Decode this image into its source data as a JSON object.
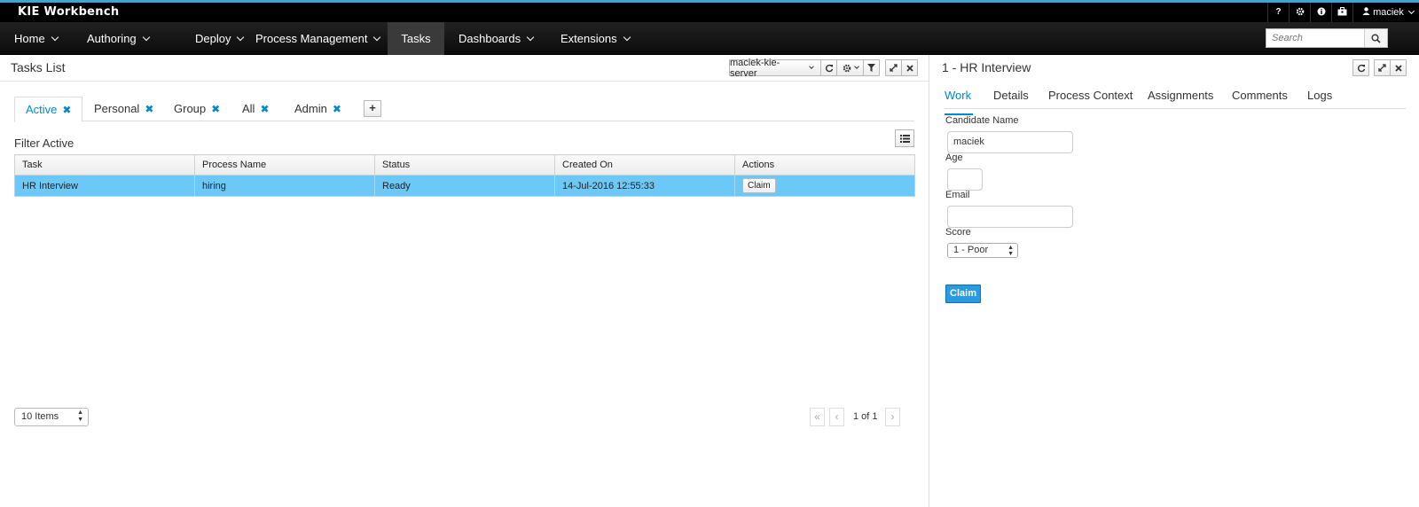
{
  "app": {
    "brand": "KIE Workbench",
    "user": "maciek"
  },
  "nav": {
    "items": [
      {
        "label": "Home",
        "dropdown": true
      },
      {
        "label": "Authoring",
        "dropdown": true
      },
      {
        "label": "Deploy",
        "dropdown": true
      },
      {
        "label": "Process Management",
        "dropdown": true
      },
      {
        "label": "Tasks",
        "dropdown": false,
        "active": true
      },
      {
        "label": "Dashboards",
        "dropdown": true
      },
      {
        "label": "Extensions",
        "dropdown": true
      }
    ],
    "search_placeholder": "Search"
  },
  "utility_icons": [
    "help-icon",
    "gear-icon",
    "info-icon",
    "briefcase-icon",
    "user-icon"
  ],
  "tasks_panel": {
    "title": "Tasks List",
    "server_select": "maciek-kie-server",
    "tabs": [
      {
        "label": "Active",
        "active": true
      },
      {
        "label": "Personal"
      },
      {
        "label": "Group"
      },
      {
        "label": "All"
      },
      {
        "label": "Admin"
      }
    ],
    "add_tab_label": "+",
    "filter_label": "Filter Active",
    "table": {
      "columns": [
        "Task",
        "Process Name",
        "Status",
        "Created On",
        "Actions"
      ],
      "rows": [
        {
          "task": "HR Interview",
          "process": "hiring",
          "status": "Ready",
          "created": "14-Jul-2016 12:55:33",
          "action": "Claim"
        }
      ]
    },
    "page_size": "10 Items",
    "pager": {
      "first": "«",
      "prev": "‹",
      "text": "1 of 1",
      "next": "›"
    }
  },
  "detail_panel": {
    "title": "1 - HR Interview",
    "tabs": [
      "Work",
      "Details",
      "Process Context",
      "Assignments",
      "Comments",
      "Logs"
    ],
    "active_tab": "Work",
    "form": {
      "candidate_label": "Candidate Name",
      "candidate_value": "maciek",
      "age_label": "Age",
      "age_value": "",
      "email_label": "Email",
      "email_value": "",
      "score_label": "Score",
      "score_value": "1 - Poor"
    },
    "claim_label": "Claim"
  },
  "colors": {
    "accent": "#0088ce",
    "selected_row": "#6cc9f7",
    "topbar_stripe": "#39a5dc",
    "primary_button": "#2a9be0"
  }
}
